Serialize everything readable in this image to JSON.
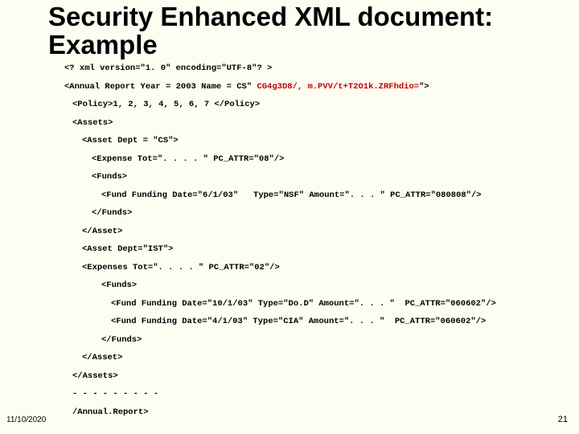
{
  "title": "Security Enhanced XML document: Example",
  "footer": {
    "date": "11/10/2020",
    "page": "21"
  },
  "code": {
    "l0": "<? xml version=\"1. 0\" encoding=\"UTF-8\"? >",
    "l1a": "<Annual Report Year = 2003 Name = CS\"",
    "l1b": " CG4g3D8/, m.PVV/t+T2O1k.ZRFhdio=",
    "l1c": "\">",
    "l2": "<Policy>1, 2, 3, 4, 5, 6, 7 </Policy>",
    "l3": "<Assets>",
    "l4": "<Asset Dept = \"CS\">",
    "l5": "<Expense Tot=\". . . . \" PC_ATTR=\"08\"/>",
    "l6": "<Funds>",
    "l7": "<Fund Funding Date=\"6/1/03\"   Type=\"NSF\" Amount=\". . . \" PC_ATTR=\"080808\"/>",
    "l8": "</Funds>",
    "l9": "</Asset>",
    "l10": "<Asset Dept=\"IST\">",
    "l11": "<Expenses Tot=\". . . . \" PC_ATTR=\"02\"/>",
    "l12": "<Funds>",
    "l13": "<Fund Funding Date=\"10/1/03\" Type=\"Do.D\" Amount=\". . . \"  PC_ATTR=\"060602\"/>",
    "l14": "<Fund Funding Date=\"4/1/03\" Type=\"CIA\" Amount=\". . . \"  PC_ATTR=\"060602\"/>",
    "l15": "</Funds>",
    "l16": "</Asset>",
    "l17": "</Assets>",
    "l18": "- - - - - - - - -",
    "l19": "/Annual.Report>"
  }
}
